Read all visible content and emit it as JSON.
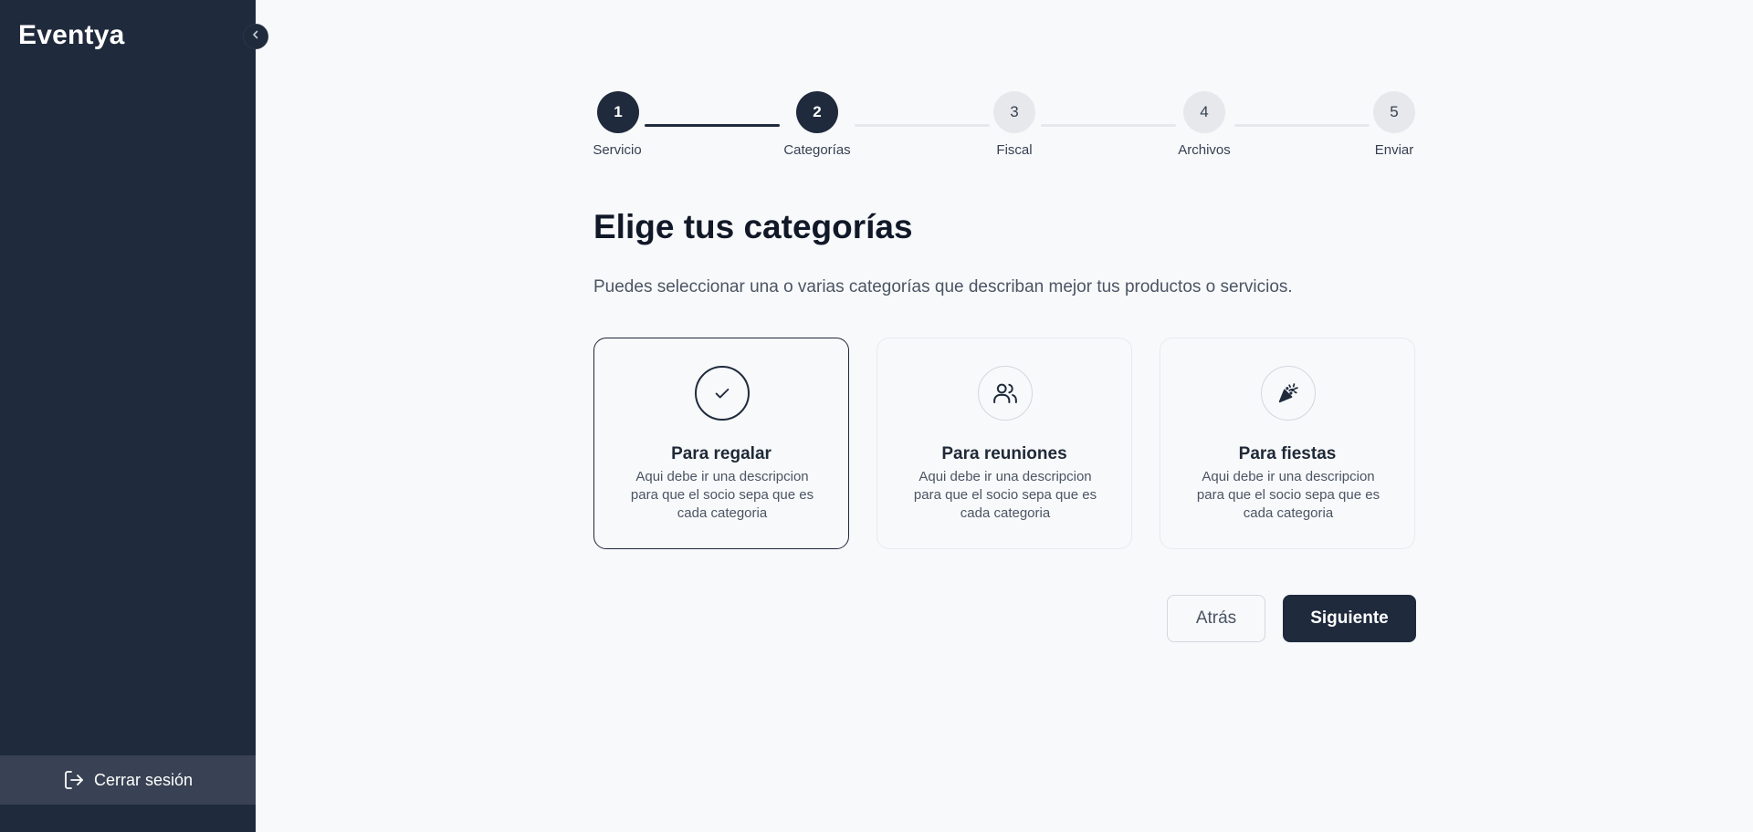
{
  "sidebar": {
    "brand": "Eventya",
    "collapse_icon": "chevron-left-icon",
    "logout_label": "Cerrar sesión",
    "logout_icon": "logout-icon"
  },
  "stepper": {
    "steps": [
      {
        "number": "1",
        "label": "Servicio",
        "state": "complete"
      },
      {
        "number": "2",
        "label": "Categorías",
        "state": "current"
      },
      {
        "number": "3",
        "label": "Fiscal",
        "state": "upcoming"
      },
      {
        "number": "4",
        "label": "Archivos",
        "state": "upcoming"
      },
      {
        "number": "5",
        "label": "Enviar",
        "state": "upcoming"
      }
    ]
  },
  "main": {
    "title": "Elige tus categorías",
    "subtitle": "Puedes seleccionar una o varias categorías que describan mejor tus productos o servicios."
  },
  "categories": [
    {
      "title": "Para regalar",
      "description": "Aqui debe ir una descripcion para que el socio sepa que es cada categoria",
      "icon": "check-icon",
      "selected": true
    },
    {
      "title": "Para reuniones",
      "description": "Aqui debe ir una descripcion para que el socio sepa que es cada categoria",
      "icon": "users-icon",
      "selected": false
    },
    {
      "title": "Para fiestas",
      "description": "Aqui debe ir una descripcion para que el socio sepa que es cada categoria",
      "icon": "party-popper-icon",
      "selected": false
    }
  ],
  "actions": {
    "back_label": "Atrás",
    "next_label": "Siguiente"
  },
  "colors": {
    "sidebar_bg": "#1f2a3c",
    "accent": "#1f2a3c",
    "page_bg": "#f8f9fb"
  }
}
